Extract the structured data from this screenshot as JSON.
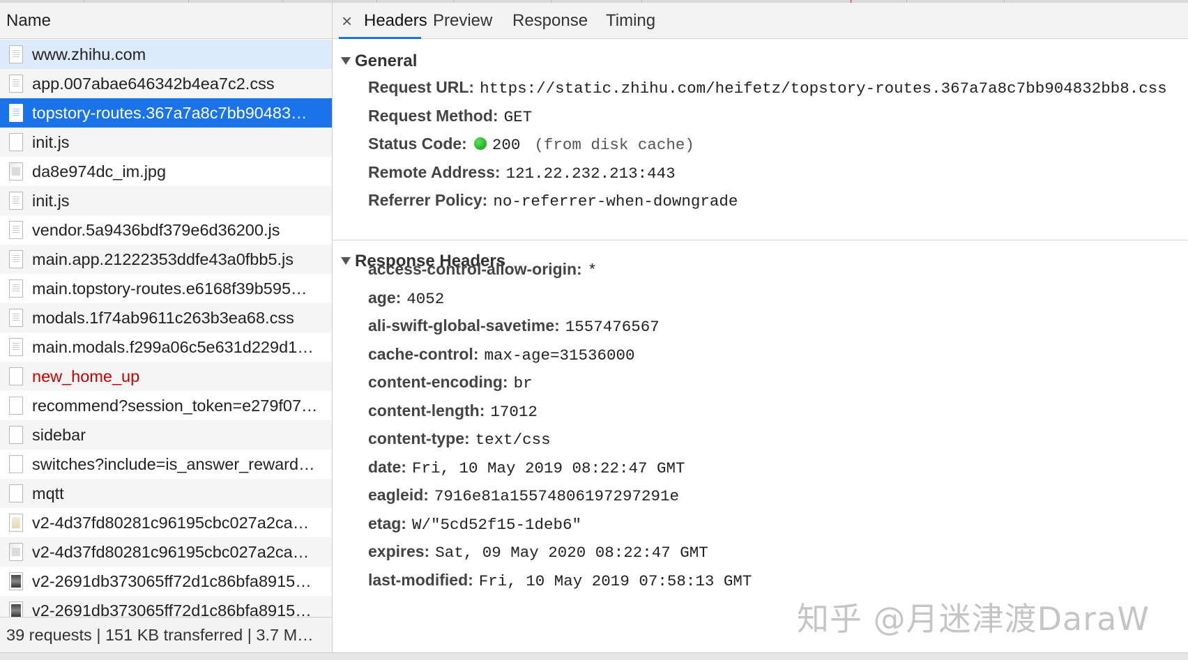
{
  "network": {
    "name_header": "Name",
    "requests": [
      {
        "name": "www.zhihu.com",
        "icon": "document-icon",
        "state": "hover"
      },
      {
        "name": "app.007abae646342b4ea7c2.css",
        "icon": "document-icon",
        "state": ""
      },
      {
        "name": "topstory-routes.367a7a8c7bb90483…",
        "icon": "document-icon",
        "state": "selected"
      },
      {
        "name": "init.js",
        "icon": "blank-file-icon",
        "state": ""
      },
      {
        "name": "da8e974dc_im.jpg",
        "icon": "image-icon",
        "state": ""
      },
      {
        "name": "init.js",
        "icon": "document-icon",
        "state": ""
      },
      {
        "name": "vendor.5a9436bdf379e6d36200.js",
        "icon": "document-icon",
        "state": ""
      },
      {
        "name": "main.app.21222353ddfe43a0fbb5.js",
        "icon": "document-icon",
        "state": ""
      },
      {
        "name": "main.topstory-routes.e6168f39b595…",
        "icon": "document-icon",
        "state": ""
      },
      {
        "name": "modals.1f74ab9611c263b3ea68.css",
        "icon": "document-icon",
        "state": ""
      },
      {
        "name": "main.modals.f299a06c5e631d229d1…",
        "icon": "document-icon",
        "state": ""
      },
      {
        "name": "new_home_up",
        "icon": "blank-file-icon",
        "state": "error"
      },
      {
        "name": "recommend?session_token=e279f07…",
        "icon": "blank-file-icon",
        "state": ""
      },
      {
        "name": "sidebar",
        "icon": "blank-file-icon",
        "state": ""
      },
      {
        "name": "switches?include=is_answer_reward…",
        "icon": "blank-file-icon",
        "state": ""
      },
      {
        "name": "mqtt",
        "icon": "blank-file-icon",
        "state": ""
      },
      {
        "name": "v2-4d37fd80281c96195cbc027a2ca…",
        "icon": "image-light-icon",
        "state": ""
      },
      {
        "name": "v2-4d37fd80281c96195cbc027a2ca…",
        "icon": "image-icon",
        "state": ""
      },
      {
        "name": "v2-2691db373065ff72d1c86bfa8915…",
        "icon": "image-dark-icon",
        "state": ""
      },
      {
        "name": "v2-2691db373065ff72d1c86bfa8915…",
        "icon": "image-dark-icon",
        "state": ""
      }
    ],
    "summary": "39 requests | 151 KB transferred | 3.7 M…"
  },
  "detail": {
    "close_glyph": "×",
    "tabs": [
      {
        "label": "Headers",
        "active": true
      },
      {
        "label": "Preview",
        "active": false
      },
      {
        "label": "Response",
        "active": false
      },
      {
        "label": "Timing",
        "active": false
      }
    ],
    "general": {
      "title": "General",
      "rows": [
        {
          "key": "Request URL:",
          "value": "https://static.zhihu.com/heifetz/topstory-routes.367a7a8c7bb904832bb8.css"
        },
        {
          "key": "Request Method:",
          "value": "GET"
        },
        {
          "key": "Status Code:",
          "value": "200",
          "note": "(from disk cache)",
          "status_color": "#1aa31a"
        },
        {
          "key": "Remote Address:",
          "value": "121.22.232.213:443"
        },
        {
          "key": "Referrer Policy:",
          "value": "no-referrer-when-downgrade"
        }
      ]
    },
    "response_headers": {
      "title": "Response Headers",
      "rows": [
        {
          "key": "access-control-allow-origin:",
          "value": "*"
        },
        {
          "key": "age:",
          "value": "4052"
        },
        {
          "key": "ali-swift-global-savetime:",
          "value": "1557476567"
        },
        {
          "key": "cache-control:",
          "value": "max-age=31536000"
        },
        {
          "key": "content-encoding:",
          "value": "br"
        },
        {
          "key": "content-length:",
          "value": "17012"
        },
        {
          "key": "content-type:",
          "value": "text/css"
        },
        {
          "key": "date:",
          "value": "Fri, 10 May 2019 08:22:47 GMT"
        },
        {
          "key": "eagleid:",
          "value": "7916e81a15574806197297291e"
        },
        {
          "key": "etag:",
          "value": "W/\"5cd52f15-1deb6\""
        },
        {
          "key": "expires:",
          "value": "Sat, 09 May 2020 08:22:47 GMT"
        },
        {
          "key": "last-modified:",
          "value": "Fri, 10 May 2019 07:58:13 GMT"
        }
      ]
    }
  },
  "watermark": "知乎 @月迷津渡DaraW",
  "colors": {
    "accent": "#1a73e8",
    "selected_row": "#1a73e8",
    "hover_row": "#dceafc",
    "error_text": "#c80000"
  }
}
